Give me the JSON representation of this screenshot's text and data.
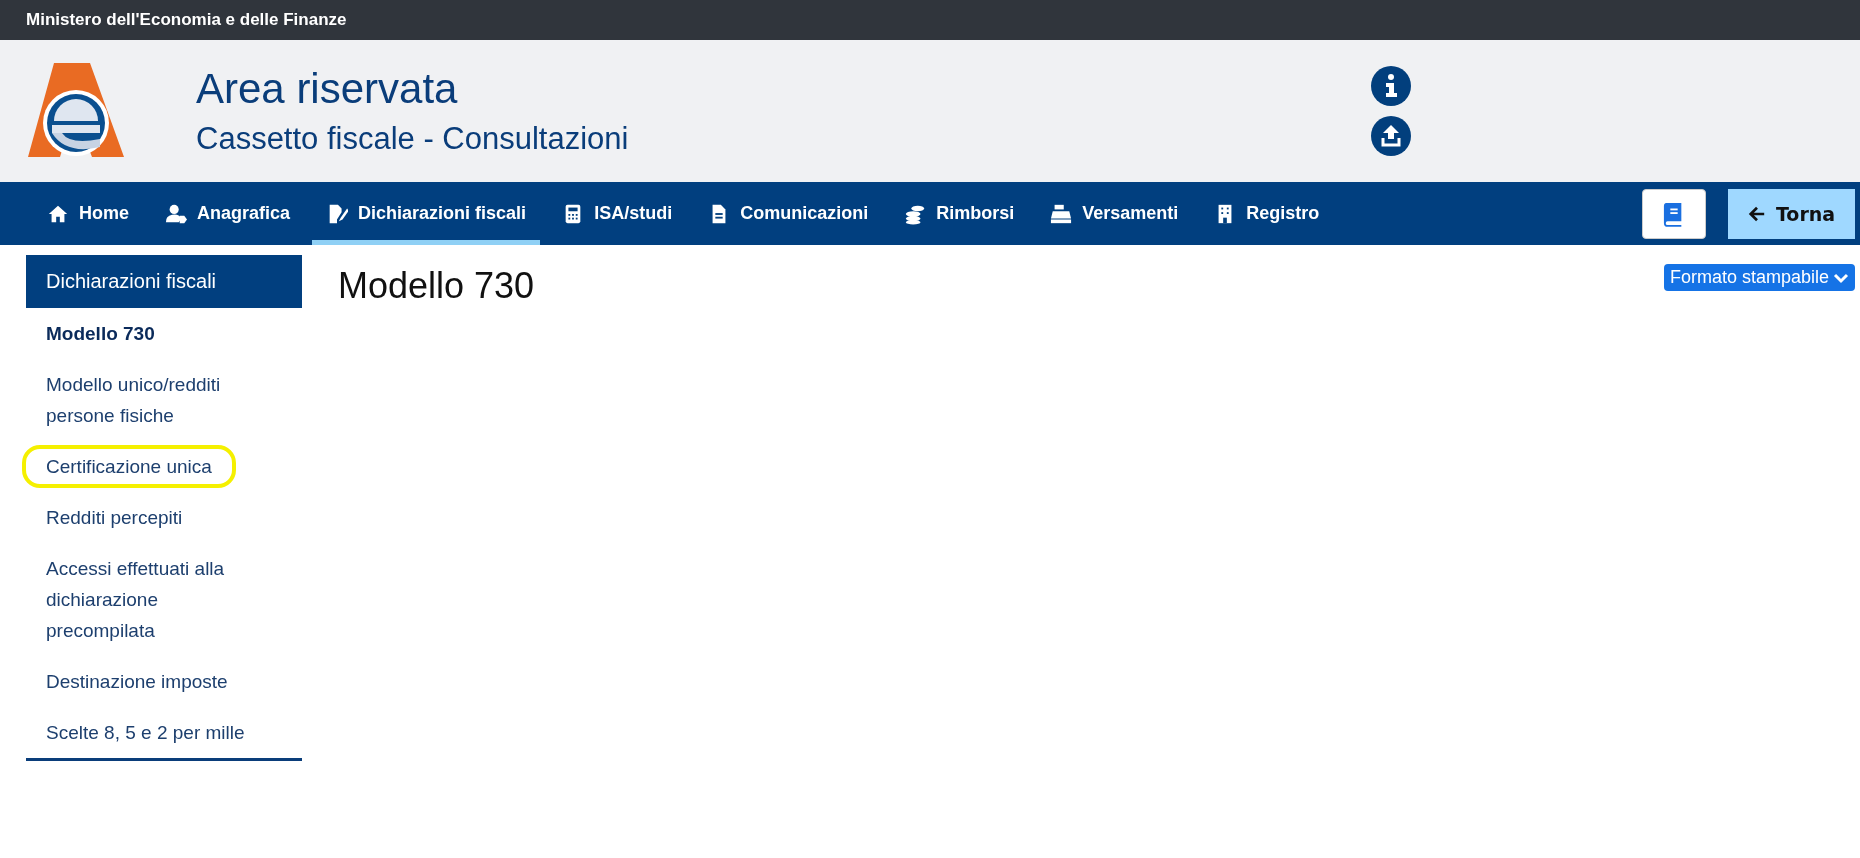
{
  "top_bar": {
    "title": "Ministero dell'Economia e delle Finanze"
  },
  "header": {
    "title": "Area riservata",
    "subtitle": "Cassetto fiscale - Consultazioni"
  },
  "nav": {
    "items": [
      {
        "label": "Home",
        "selected": false
      },
      {
        "label": "Anagrafica",
        "selected": false
      },
      {
        "label": "Dichiarazioni fiscali",
        "selected": true
      },
      {
        "label": "ISA/studi",
        "selected": false
      },
      {
        "label": "Comunicazioni",
        "selected": false
      },
      {
        "label": "Rimborsi",
        "selected": false
      },
      {
        "label": "Versamenti",
        "selected": false
      },
      {
        "label": "Registro",
        "selected": false
      }
    ],
    "back_button": "Torna"
  },
  "sidebar": {
    "title": "Dichiarazioni fiscali",
    "items": [
      {
        "label": "Modello 730",
        "selected": true,
        "highlighted": false
      },
      {
        "label": "Modello unico/redditi persone fisiche",
        "selected": false,
        "highlighted": false
      },
      {
        "label": "Certificazione unica",
        "selected": false,
        "highlighted": true
      },
      {
        "label": "Redditi percepiti",
        "selected": false,
        "highlighted": false
      },
      {
        "label": "Accessi effettuati alla dichiarazione precompilata",
        "selected": false,
        "highlighted": false
      },
      {
        "label": "Destinazione imposte",
        "selected": false,
        "highlighted": false
      },
      {
        "label": "Scelte 8, 5 e 2 per mille",
        "selected": false,
        "highlighted": false
      }
    ]
  },
  "main": {
    "title": "Modello 730",
    "print_button": "Formato stampabile"
  }
}
